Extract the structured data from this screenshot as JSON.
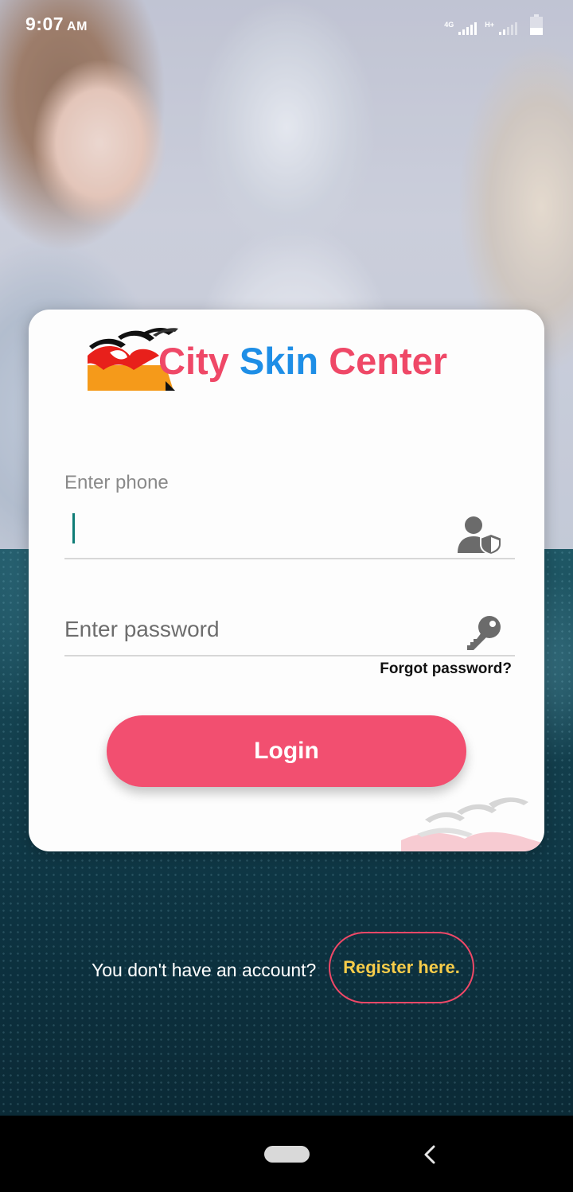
{
  "status_bar": {
    "time": "9:07",
    "ampm": "AM",
    "network_1": "4G",
    "network_2": "H+"
  },
  "brand": {
    "title_word1": "City",
    "title_word2": "Skin",
    "title_word3": "Center",
    "colors": {
      "pink": "#ef4867",
      "blue": "#1e8ee6"
    }
  },
  "login_form": {
    "phone_label": "Enter phone",
    "phone_value": "",
    "password_placeholder": "Enter password",
    "forgot_password": "Forgot password?",
    "login_button": "Login"
  },
  "register": {
    "prompt": "You don't have an account?",
    "link": "Register here."
  },
  "icons": {
    "phone_field": "user-shield-icon",
    "password_field": "key-icon",
    "nav_back": "back-icon"
  }
}
